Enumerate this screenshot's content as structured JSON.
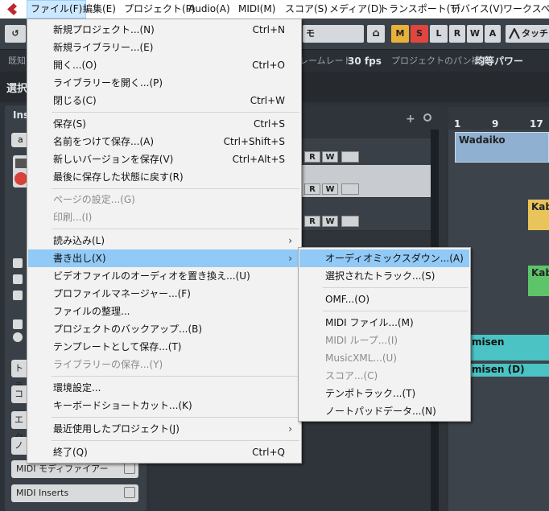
{
  "menubar": {
    "items": [
      "ファイル(F)",
      "編集(E)",
      "プロジェクト(P)",
      "Audio(A)",
      "MIDI(M)",
      "スコア(S)",
      "メディア(D)",
      "トランスポート(T)",
      "デバイス(V)",
      "ワークスペース"
    ],
    "active_index": 0
  },
  "toolbar": {
    "mode_field": "モ",
    "buttons": [
      "M",
      "S",
      "L",
      "R",
      "W",
      "A"
    ],
    "touch_label": "タッチ"
  },
  "infobar": {
    "left_label": "既知",
    "framerate_label": "レームレート",
    "framerate_value": "30 fps",
    "pan_label": "プロジェクトのパン補正",
    "pan_value": "均等パワー"
  },
  "subbar": {
    "label": "選択"
  },
  "inspector": {
    "title": "Ins",
    "tab1": "a",
    "side_buttons": [
      "トラ",
      "コー",
      "エク",
      "ノー"
    ],
    "midi_modifiers": "MIDI モディファイアー",
    "midi_inserts": "MIDI Inserts"
  },
  "ruler": {
    "bars": [
      "1",
      "9",
      "17"
    ]
  },
  "events": {
    "wadaiko": "Wadaiko",
    "kab1": "Kab",
    "kab2": "Kab",
    "misen1": "misen",
    "misen2": "misen (D)"
  },
  "track_buttons": {
    "r": "R",
    "w": "W"
  },
  "file_menu": {
    "items": [
      {
        "label": "新規プロジェクト...(N)",
        "shortcut": "Ctrl+N"
      },
      {
        "label": "新規ライブラリー...(E)",
        "shortcut": ""
      },
      {
        "label": "開く...(O)",
        "shortcut": "Ctrl+O"
      },
      {
        "label": "ライブラリーを開く...(P)",
        "shortcut": ""
      },
      {
        "label": "閉じる(C)",
        "shortcut": "Ctrl+W"
      },
      {
        "label": "保存(S)",
        "shortcut": "Ctrl+S"
      },
      {
        "label": "名前をつけて保存...(A)",
        "shortcut": "Ctrl+Shift+S"
      },
      {
        "label": "新しいバージョンを保存(V)",
        "shortcut": "Ctrl+Alt+S"
      },
      {
        "label": "最後に保存した状態に戻す(R)",
        "shortcut": ""
      },
      {
        "label": "ページの設定...(G)",
        "shortcut": ""
      },
      {
        "label": "印刷...(I)",
        "shortcut": ""
      },
      {
        "label": "読み込み(L)",
        "shortcut": ""
      },
      {
        "label": "書き出し(X)",
        "shortcut": ""
      },
      {
        "label": "ビデオファイルのオーディオを置き換え...(U)",
        "shortcut": ""
      },
      {
        "label": "プロファイルマネージャー...(F)",
        "shortcut": ""
      },
      {
        "label": "ファイルの整理...",
        "shortcut": ""
      },
      {
        "label": "プロジェクトのバックアップ...(B)",
        "shortcut": ""
      },
      {
        "label": "テンプレートとして保存...(T)",
        "shortcut": ""
      },
      {
        "label": "ライブラリーの保存...(Y)",
        "shortcut": ""
      },
      {
        "label": "環境設定...",
        "shortcut": ""
      },
      {
        "label": "キーボードショートカット...(K)",
        "shortcut": ""
      },
      {
        "label": "最近使用したプロジェクト(J)",
        "shortcut": ""
      },
      {
        "label": "終了(Q)",
        "shortcut": "Ctrl+Q"
      }
    ]
  },
  "export_submenu": {
    "items": [
      {
        "label": "オーディオミックスダウン...(A)"
      },
      {
        "label": "選択されたトラック...(S)"
      },
      {
        "label": "OMF...(O)"
      },
      {
        "label": "MIDI ファイル...(M)"
      },
      {
        "label": "MIDI ループ...(I)"
      },
      {
        "label": "MusicXML...(U)"
      },
      {
        "label": "スコア...(C)"
      },
      {
        "label": "テンポトラック...(T)"
      },
      {
        "label": "ノートパッドデータ...(N)"
      }
    ]
  },
  "colors": {
    "menu_bg": "#f2f2f2",
    "highlight": "#91c9f7",
    "menubar_active": "#cce8ff",
    "mute": "#e8b13a",
    "solo": "#e0453f",
    "event_blue": "#8fb0d0",
    "event_yellow": "#e8c45a",
    "event_green": "#5ec46a",
    "event_teal": "#4bc3c4"
  }
}
